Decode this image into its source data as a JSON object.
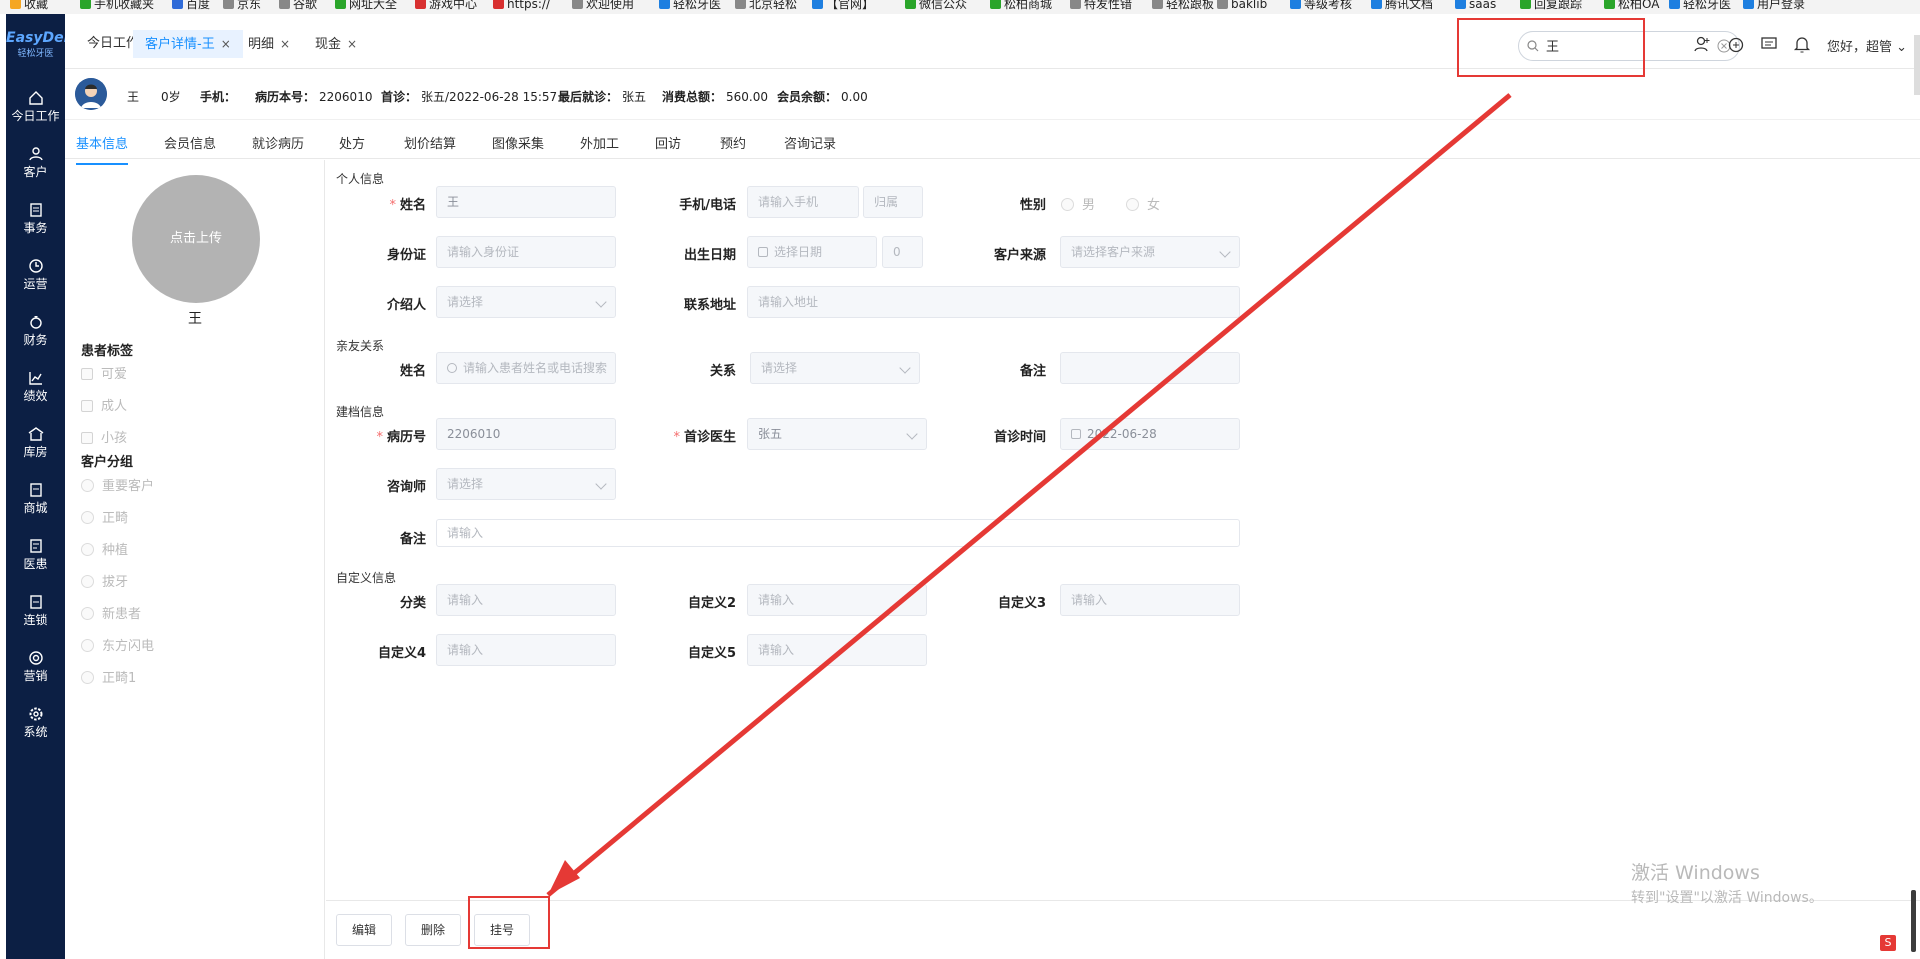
{
  "bookmarks": [
    {
      "label": "收藏",
      "color": "#f5a623"
    },
    {
      "label": "手机收藏夹",
      "color": "#2aa52a"
    },
    {
      "label": "百度",
      "color": "#2f6bd8"
    },
    {
      "label": "京东",
      "color": "#888888"
    },
    {
      "label": "谷歌",
      "color": "#888888"
    },
    {
      "label": "网址大全",
      "color": "#2aa52a"
    },
    {
      "label": "游戏中心",
      "color": "#d83030"
    },
    {
      "label": "https://",
      "color": "#d83030"
    },
    {
      "label": "欢迎使用",
      "color": "#888888"
    },
    {
      "label": "轻松牙医",
      "color": "#1e7fe0"
    },
    {
      "label": "北京轻松",
      "color": "#888888"
    },
    {
      "label": "【官网】",
      "color": "#1e7fe0"
    },
    {
      "label": "微信公众",
      "color": "#2aa52a"
    },
    {
      "label": "松柏商城",
      "color": "#2aa52a"
    },
    {
      "label": "特发性错",
      "color": "#888888"
    },
    {
      "label": "轻松跟板",
      "color": "#888888"
    },
    {
      "label": "baklib",
      "color": "#888888"
    },
    {
      "label": "等级考核",
      "color": "#1e7fe0"
    },
    {
      "label": "腾讯文档",
      "color": "#1e7fe0"
    },
    {
      "label": "saas",
      "color": "#1e7fe0"
    },
    {
      "label": "回复跟踪",
      "color": "#2aa52a"
    },
    {
      "label": "松柏OA",
      "color": "#2aa52a"
    },
    {
      "label": "轻松牙医",
      "color": "#1e7fe0"
    },
    {
      "label": "用户登录",
      "color": "#1e7fe0"
    }
  ],
  "sidebar": {
    "logo": "EasyDent",
    "logo_sub": "轻松牙医",
    "items": [
      {
        "label": "今日工作",
        "icon": "home-icon"
      },
      {
        "label": "客户",
        "icon": "user-icon"
      },
      {
        "label": "事务",
        "icon": "task-icon"
      },
      {
        "label": "运营",
        "icon": "clock-icon"
      },
      {
        "label": "财务",
        "icon": "finance-icon"
      },
      {
        "label": "绩效",
        "icon": "chart-icon"
      },
      {
        "label": "库房",
        "icon": "warehouse-icon"
      },
      {
        "label": "商城",
        "icon": "shop-icon"
      },
      {
        "label": "医患",
        "icon": "doc-icon"
      },
      {
        "label": "连锁",
        "icon": "chain-icon"
      },
      {
        "label": "营销",
        "icon": "target-icon"
      },
      {
        "label": "系统",
        "icon": "gear-icon"
      }
    ]
  },
  "tabs": [
    {
      "label": "今日工作"
    },
    {
      "label": "客户详情-王",
      "closable": "×"
    },
    {
      "label": "明细",
      "closable": "×"
    },
    {
      "label": "现金",
      "closable": "×"
    }
  ],
  "search": {
    "value": "王"
  },
  "header": {
    "greeting": "您好，超管"
  },
  "patient": {
    "name": "王",
    "age": "0岁",
    "phone_label": "手机：",
    "record_label": "病历本号：",
    "record_no": "2206010",
    "first_visit_label": "首诊：",
    "first_visit": "张五/2022-06-28 15:57",
    "last_visit_label": "最后就诊：",
    "last_visit": "张五",
    "total_label": "消费总额：",
    "total": "560.00",
    "balance_label": "会员余额：",
    "balance": "0.00"
  },
  "subtabs": [
    "基本信息",
    "会员信息",
    "就诊病历",
    "处方",
    "划价结算",
    "图像采集",
    "外加工",
    "回访",
    "预约",
    "咨询记录"
  ],
  "left_panel": {
    "upload_label": "点击上传",
    "name": "王",
    "tags_title": "患者标签",
    "tags": [
      "可爱",
      "成人",
      "小孩"
    ],
    "groups_title": "客户分组",
    "groups": [
      "重要客户",
      "正畸",
      "种植",
      "拔牙",
      "新患者",
      "东方闪电",
      "正畸1"
    ]
  },
  "form": {
    "sec_personal": "个人信息",
    "name_label": "姓名",
    "name_value": "王",
    "phone_label": "手机/电话",
    "phone_ph": "请输入手机",
    "phone_belong": "归属",
    "gender_label": "性别",
    "gender_male": "男",
    "gender_female": "女",
    "id_label": "身份证",
    "id_ph": "请输入身份证",
    "birth_label": "出生日期",
    "birth_ph": "选择日期",
    "birth_age": "0",
    "source_label": "客户来源",
    "source_ph": "请选择客户来源",
    "referrer_label": "介绍人",
    "referrer_ph": "请选择",
    "address_label": "联系地址",
    "address_ph": "请输入地址",
    "sec_relation": "亲友关系",
    "rel_name_label": "姓名",
    "rel_name_ph": "请输入患者姓名或电话搜索",
    "rel_label": "关系",
    "rel_ph": "请选择",
    "rel_note_label": "备注",
    "sec_archive": "建档信息",
    "record_label": "病历号",
    "record_value": "2206010",
    "doctor_label": "首诊医生",
    "doctor_value": "张五",
    "first_time_label": "首诊时间",
    "first_time_value": "2022-06-28",
    "consultant_label": "咨询师",
    "consultant_ph": "请选择",
    "note_label": "备注",
    "note_ph": "请输入",
    "sec_custom": "自定义信息",
    "cat_label": "分类",
    "cat_ph": "请输入",
    "c2_label": "自定义2",
    "c2_ph": "请输入",
    "c3_label": "自定义3",
    "c3_ph": "请输入",
    "c4_label": "自定义4",
    "c4_ph": "请输入",
    "c5_label": "自定义5",
    "c5_ph": "请输入"
  },
  "buttons": {
    "edit": "编辑",
    "delete": "删除",
    "register": "挂号"
  },
  "watermark": {
    "line1": "激活 Windows",
    "line2": "转到\"设置\"以激活 Windows。"
  },
  "tray_badge": "S",
  "colors": {
    "accent": "#1890ff",
    "sidebar": "#0c1f44",
    "annotation": "#e53935"
  }
}
